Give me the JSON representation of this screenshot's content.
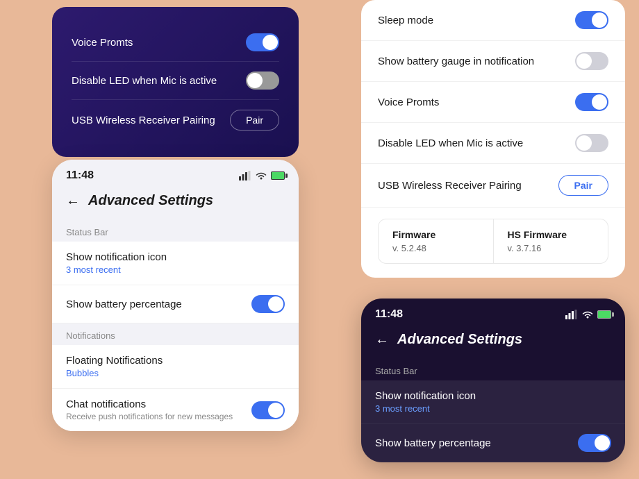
{
  "background": "#e8b898",
  "card_top_left": {
    "settings": [
      {
        "label": "Voice Promts",
        "toggle": "on"
      },
      {
        "label": "Disable LED when Mic is active",
        "toggle": "off"
      },
      {
        "label": "USB Wireless Receiver Pairing",
        "action": "Pair"
      }
    ]
  },
  "card_top_right": {
    "settings": [
      {
        "label": "Sleep mode",
        "toggle": "on"
      },
      {
        "label": "Show battery gauge in notification",
        "toggle": "off-light"
      },
      {
        "label": "Voice Promts",
        "toggle": "on"
      },
      {
        "label": "Disable LED when Mic is active",
        "toggle": "off-light"
      },
      {
        "label": "USB Wireless Receiver Pairing",
        "action": "Pair"
      }
    ],
    "firmware": [
      {
        "name": "Firmware",
        "version": "v. 5.2.48"
      },
      {
        "name": "HS Firmware",
        "version": "v. 3.7.16"
      }
    ]
  },
  "card_bottom_left": {
    "time": "11:48",
    "title": "Advanced Settings",
    "sections": [
      {
        "label": "Status Bar",
        "items": [
          {
            "main": "Show notification icon",
            "sub": "3 most recent",
            "toggle": null
          },
          {
            "main": "Show battery percentage",
            "sub": null,
            "toggle": "on"
          }
        ]
      },
      {
        "label": "Notifications",
        "items": [
          {
            "main": "Floating Notifications",
            "sub": "Bubbles",
            "toggle": null
          },
          {
            "main": "Chat notifications",
            "sub_gray": "Receive push notifications for new messages",
            "toggle": "on"
          }
        ]
      }
    ]
  },
  "card_bottom_right": {
    "time": "11:48",
    "title": "Advanced Settings",
    "sections": [
      {
        "label": "Status Bar",
        "items": [
          {
            "main": "Show notification icon",
            "sub": "3 most recent",
            "toggle": null
          },
          {
            "main": "Show battery percentage",
            "sub": null,
            "toggle": "on"
          }
        ]
      }
    ]
  }
}
